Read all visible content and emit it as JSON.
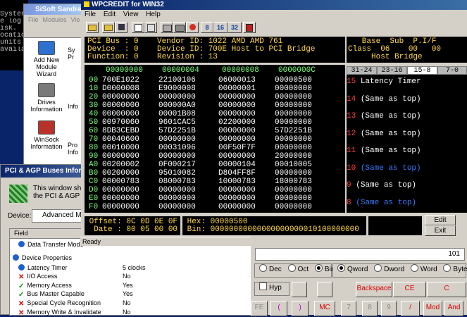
{
  "console": {
    "lines": [
      "",
      "Systen",
      "e log",
      "isk.",
      "",
      "ocatio",
      "units",
      "availa"
    ]
  },
  "sandra": {
    "title": "SiSoft Sandra",
    "menu": [
      "File",
      "Modules",
      "Vie"
    ],
    "modules": [
      {
        "name": "add-module",
        "label": "Add New Module Wizard",
        "color": "#2e6fd0"
      },
      {
        "name": "drives",
        "label": "Drives Information",
        "color": "#7a7a7a"
      },
      {
        "name": "winsock",
        "label": "WinSock Information",
        "color": "#b8312a"
      }
    ],
    "side_labels": [
      "Sy",
      "Pr",
      "Info",
      "Pro",
      "Info"
    ]
  },
  "pcidlg": {
    "title": "PCI & AGP Buses Informa",
    "note_1": "This window shows",
    "note_2": "the PCI & AGP bus",
    "device_label": "Device:",
    "device_value": "Advanced Mic",
    "field_header": "Field",
    "rows": [
      {
        "kind": "blue",
        "label": "Data Transfer Mode",
        "value": ""
      },
      {
        "kind": "header",
        "label": "Device Properties",
        "value": ""
      },
      {
        "kind": "blue",
        "label": "Latency Timer",
        "value": "5 clocks"
      },
      {
        "kind": "red",
        "label": "I/O Access",
        "value": "No"
      },
      {
        "kind": "green",
        "label": "Memory Access",
        "value": "Yes"
      },
      {
        "kind": "green",
        "label": "Bus Master Capable",
        "value": "Yes"
      },
      {
        "kind": "red",
        "label": "Special Cycle Recognition",
        "value": "No"
      },
      {
        "kind": "red",
        "label": "Memory Write & Invalidate",
        "value": "No"
      }
    ]
  },
  "status": "Ready",
  "calc": {
    "display": "101",
    "base": [
      "Dec",
      "Oct",
      "Bin"
    ],
    "word": [
      "Qword",
      "Dword",
      "Word",
      "Byte"
    ],
    "hyp": "Hyp",
    "buttons": [
      "Backspace",
      "CE",
      "C"
    ],
    "keys": [
      "FE",
      "(",
      ")",
      "MC",
      "7",
      "8",
      "9",
      "/",
      "Mod",
      "And"
    ]
  },
  "wpc": {
    "title": "WPCREDIT for WIN32",
    "menu": [
      "File",
      "Edit",
      "View",
      "Help"
    ],
    "toolbar_bits": [
      "8",
      "16",
      "32"
    ],
    "info": {
      "line1": "PCI Bus : 0    Vendor ID: 1022 AMD AMD 761",
      "line2": "Device  : 0    Device ID: 700E Host to PCI Bridge",
      "line3": "Function: 0    Revision : 13"
    },
    "classbox": {
      "hdr": "   Base  Sub  P.I/F",
      "cls": "Class  06    00   00",
      "desc": "     Host Bridge"
    },
    "columns": [
      "00000000",
      "00000004",
      "00000008",
      "0000000C"
    ],
    "rows": [
      {
        "a": "00",
        "v": [
          "700E1022",
          "22100106",
          "06000013",
          "00000500"
        ]
      },
      {
        "a": "10",
        "v": [
          "D0000008",
          "E9000008",
          "00000001",
          "00000000"
        ]
      },
      {
        "a": "20",
        "v": [
          "00000000",
          "00000000",
          "00000000",
          "00000000"
        ]
      },
      {
        "a": "30",
        "v": [
          "00000000",
          "000000A0",
          "00000000",
          "00000000"
        ]
      },
      {
        "a": "40",
        "v": [
          "00000000",
          "00001B08",
          "00000000",
          "00000000"
        ]
      },
      {
        "a": "50",
        "v": [
          "00970060",
          "9601CAC5",
          "02200000",
          "00000000"
        ]
      },
      {
        "a": "60",
        "v": [
          "8DB3CEBD",
          "57D2251B",
          "00000000",
          "57D2251B"
        ]
      },
      {
        "a": "70",
        "v": [
          "00040600",
          "00000000",
          "00000000",
          "00000000"
        ]
      },
      {
        "a": "80",
        "v": [
          "00010000",
          "00031096",
          "00F50F7F",
          "00000000"
        ]
      },
      {
        "a": "90",
        "v": [
          "00000000",
          "00000000",
          "00000000",
          "20000000"
        ]
      },
      {
        "a": "A0",
        "v": [
          "00200002",
          "0F000217",
          "00000104",
          "00010005"
        ]
      },
      {
        "a": "B0",
        "v": [
          "00200000",
          "95010082",
          "D804FF8F",
          "00000000"
        ]
      },
      {
        "a": "C0",
        "v": [
          "00000783",
          "08000783",
          "10000783",
          "18000783"
        ]
      },
      {
        "a": "D0",
        "v": [
          "00000000",
          "00000000",
          "00000000",
          "00000000"
        ]
      },
      {
        "a": "E0",
        "v": [
          "00000000",
          "00000000",
          "00000000",
          "00000000"
        ]
      },
      {
        "a": "F0",
        "v": [
          "00000000",
          "00000000",
          "00000000",
          "00000000"
        ]
      }
    ],
    "tabs": [
      "31-24",
      "23-16",
      "15-8",
      "7-0"
    ],
    "bits": [
      {
        "n": "15",
        "t": "Latency Timer",
        "blue": false
      },
      {
        "n": "14",
        "t": "(Same as top)",
        "blue": false
      },
      {
        "n": "13",
        "t": "(Same as top)",
        "blue": false
      },
      {
        "n": "12",
        "t": "(Same as top)",
        "blue": false
      },
      {
        "n": "11",
        "t": "(Same as top)",
        "blue": false
      },
      {
        "n": "10",
        "t": "(Same as top)",
        "blue": true
      },
      {
        "n": "9",
        "t": "(Same as top)",
        "blue": false
      },
      {
        "n": "8",
        "t": "(Same as top)",
        "blue": true
      }
    ],
    "offset": " Offset: 0C 0D 0E 0F",
    "date": "  Date : 00 05 00 00",
    "hex": " Hex: 00000500",
    "bin": " Bin: 00000000000000000000010100000000",
    "edit_btn": "Edit",
    "exit_btn": "Exit"
  }
}
